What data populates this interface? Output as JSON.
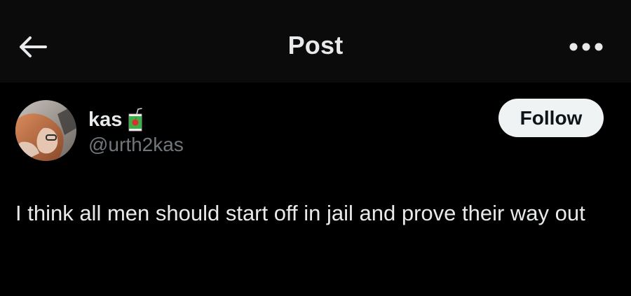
{
  "header": {
    "title": "Post",
    "back_icon": "arrow-left-icon",
    "more_icon": "more-horizontal-icon"
  },
  "author": {
    "display_name": "kas",
    "name_emoji": "juice-box-icon",
    "handle": "@urth2kas",
    "avatar": "profile-photo"
  },
  "actions": {
    "follow_label": "Follow"
  },
  "post": {
    "text": "I think all men should start off in jail and prove their way out"
  },
  "colors": {
    "background": "#000000",
    "header_background": "#0b0b0c",
    "primary_text": "#e7e9ea",
    "secondary_text": "#71767b",
    "follow_button_bg": "#eff3f4",
    "follow_button_text": "#0f1419"
  }
}
